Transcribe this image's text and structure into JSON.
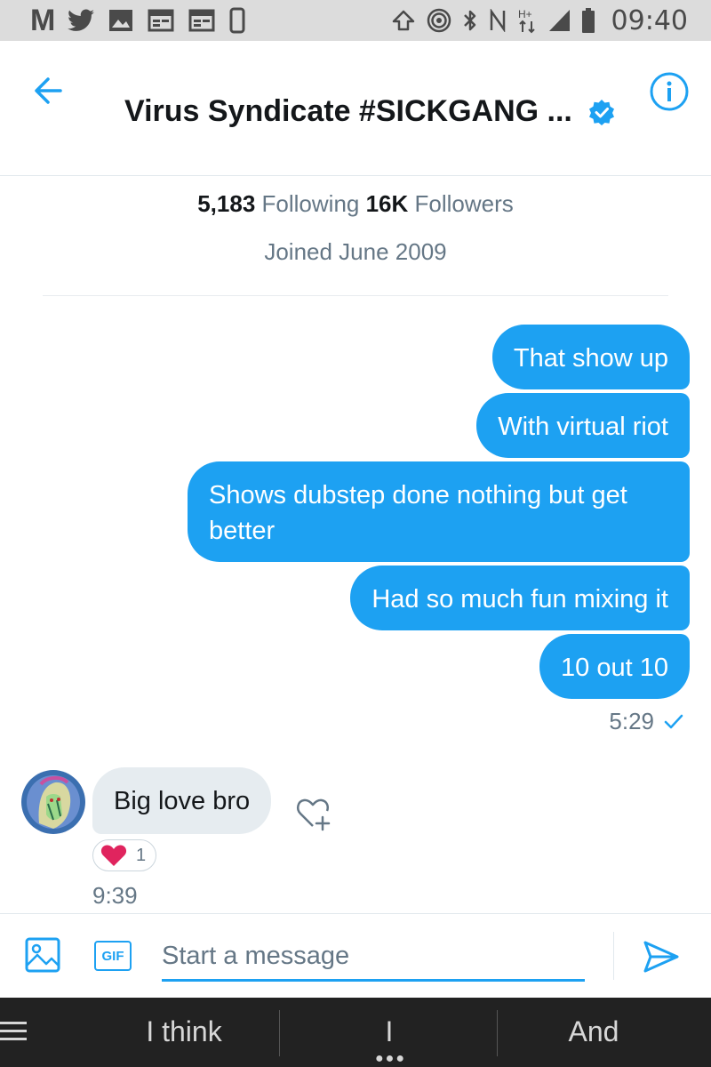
{
  "status_bar": {
    "left_icons": [
      "gmail-icon",
      "twitter-icon",
      "image-icon",
      "calendar-icon",
      "calendar-icon",
      "phone-icon"
    ],
    "right_icons": [
      "upload-icon",
      "hotspot-icon",
      "bluetooth-icon",
      "nfc-icon",
      "network-hplus-icon",
      "signal-icon",
      "battery-icon"
    ],
    "gmail_glyph": "M",
    "network_label": "H+",
    "time": "09:40"
  },
  "header": {
    "title": "Virus Syndicate #SICKGANG ...",
    "verified": true
  },
  "profile": {
    "following_count": "5,183",
    "following_label": "Following",
    "followers_count": "16K",
    "followers_label": "Followers",
    "joined": "Joined June 2009"
  },
  "messages": {
    "sent": [
      "That show up",
      "With virtual riot",
      "Shows dubstep done nothing but get better",
      "Had so much fun mixing it",
      "10 out 10"
    ],
    "sent_time": "5:29",
    "received": {
      "text": "Big love bro",
      "reaction_count": "1",
      "time": "9:39"
    }
  },
  "composer": {
    "gif_label": "GIF",
    "placeholder": "Start a message"
  },
  "keyboard": {
    "suggestions": [
      "I think",
      "I",
      "And"
    ]
  },
  "colors": {
    "accent": "#1da1f2",
    "received_bubble": "#e6ecf0",
    "muted_text": "#657786",
    "reaction_heart": "#e0245e"
  }
}
